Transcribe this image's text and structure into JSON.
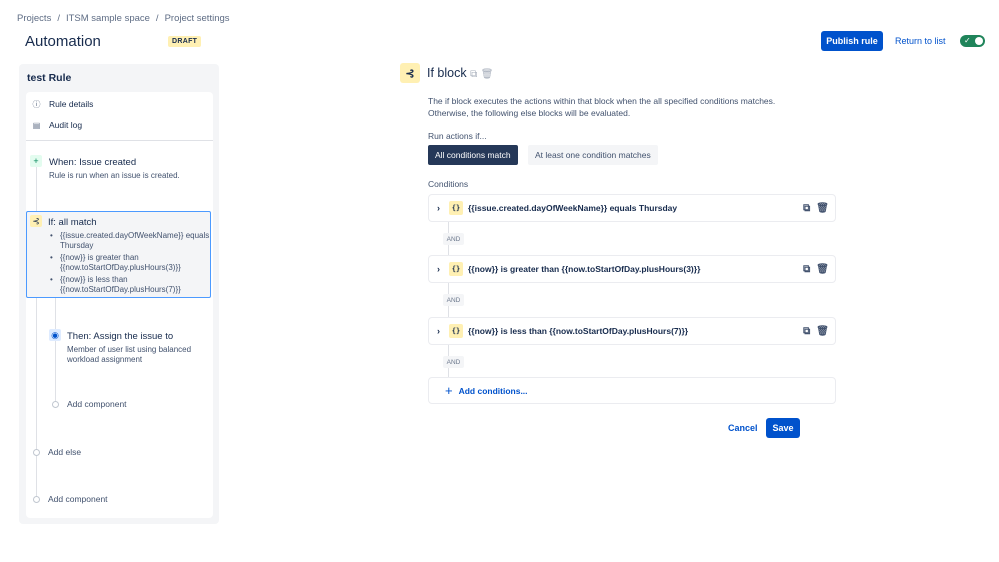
{
  "breadcrumb": [
    "Projects",
    "ITSM sample space",
    "Project settings"
  ],
  "header": {
    "title": "Automation",
    "badge": "DRAFT",
    "publish": "Publish rule",
    "return": "Return to list",
    "enabled": true
  },
  "rule": {
    "name": "test Rule",
    "menu": [
      {
        "icon": "info-icon",
        "label": "Rule details"
      },
      {
        "icon": "audit-log-icon",
        "label": "Audit log"
      }
    ],
    "trigger": {
      "title": "When: Issue created",
      "subtitle": "Rule is run when an issue is created."
    },
    "if": {
      "title": "If: all match",
      "items": [
        "{{issue.created.dayOfWeekName}} equals Thursday",
        "{{now}} is greater than {{now.toStartOfDay.plusHours(3)}}",
        "{{now}} is less than {{now.toStartOfDay.plusHours(7)}}"
      ]
    },
    "then": {
      "title": "Then: Assign the issue to",
      "subtitle": "Member of user list using balanced workload assignment"
    },
    "add_component": "Add component",
    "add_else": "Add else",
    "add_component2": "Add component"
  },
  "editor": {
    "title": "If block",
    "description": [
      "The if block executes the actions within that block when the all specified conditions matches.",
      "Otherwise, the following else blocks will be evaluated."
    ],
    "run_label": "Run actions if...",
    "options": [
      "All conditions match",
      "At least one condition matches"
    ],
    "selected": 0,
    "conditions_label": "Conditions",
    "conditions": [
      "{{issue.created.dayOfWeekName}} equals Thursday",
      "{{now}} is greater than {{now.toStartOfDay.plusHours(3)}}",
      "{{now}} is less than {{now.toStartOfDay.plusHours(7)}}"
    ],
    "and": "AND",
    "add_conditions": "Add conditions...",
    "cancel": "Cancel",
    "save": "Save"
  }
}
